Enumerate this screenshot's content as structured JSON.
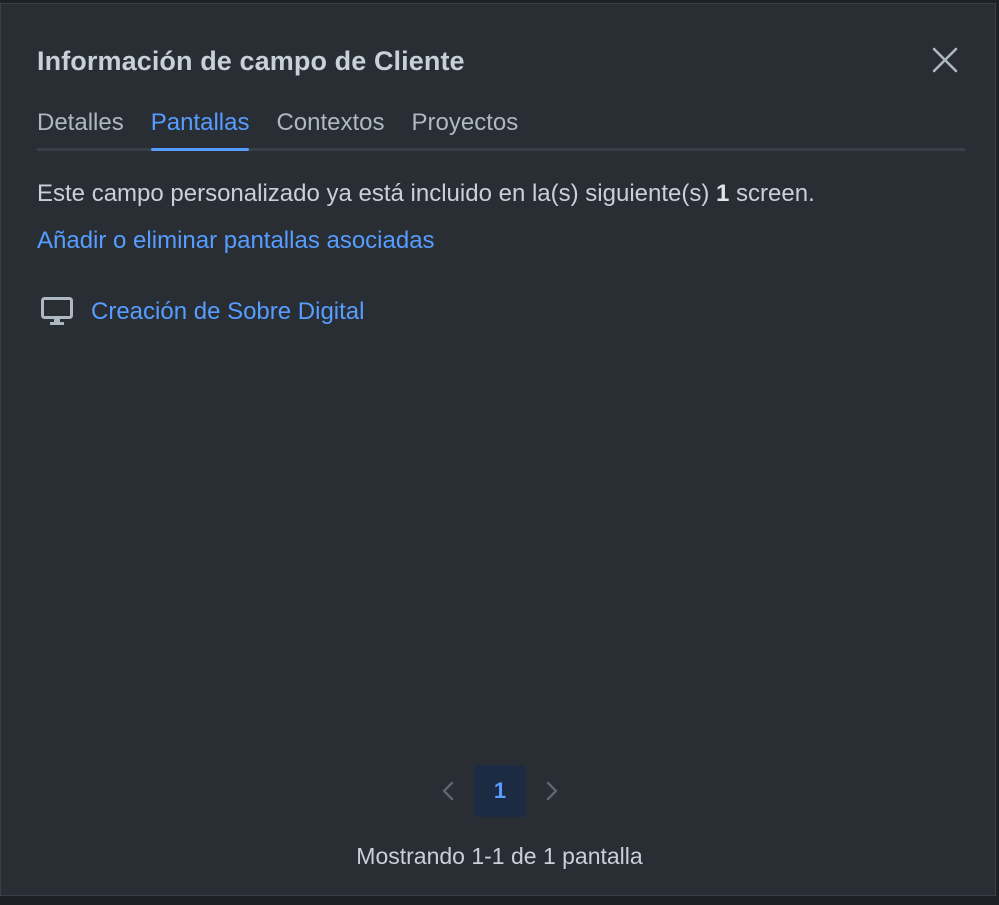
{
  "dialog": {
    "title": "Información de campo de Cliente"
  },
  "tabs": [
    {
      "label": "Detalles",
      "active": false
    },
    {
      "label": "Pantallas",
      "active": true
    },
    {
      "label": "Contextos",
      "active": false
    },
    {
      "label": "Proyectos",
      "active": false
    }
  ],
  "content": {
    "desc_before": "Este campo personalizado ya está incluido en la(s) siguiente(s) ",
    "desc_count": "1",
    "desc_after": " screen.",
    "link_label": "Añadir o eliminar pantallas asociadas",
    "screens": [
      {
        "icon": "monitor-icon",
        "label": "Creación de Sobre Digital"
      }
    ]
  },
  "pagination": {
    "current_page": "1",
    "summary": "Mostrando 1-1 de 1 pantalla"
  },
  "colors": {
    "accent": "#579dff",
    "background": "#282e33",
    "text": "#c8d0d9"
  }
}
